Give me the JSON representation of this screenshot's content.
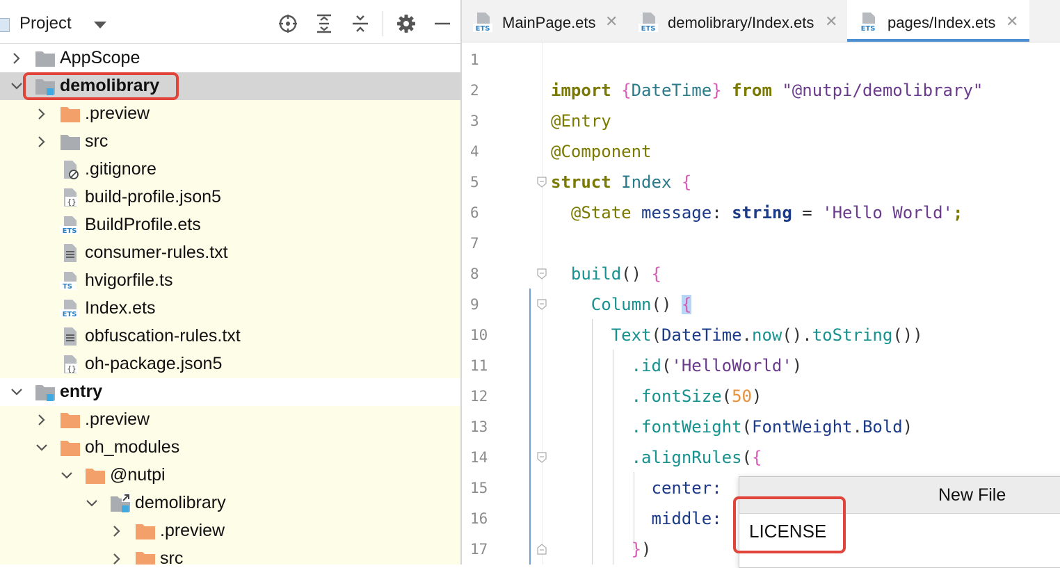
{
  "project_panel": {
    "title": "Project",
    "toolbar_icons": [
      "crosshair-icon",
      "expand-all-icon",
      "collapse-all-icon",
      "gear-icon",
      "minimize-icon"
    ],
    "tree": [
      {
        "label": "AppScope",
        "icon": "folder-icon",
        "expanded": false
      },
      {
        "label": "demolibrary",
        "icon": "module-folder-icon",
        "expanded": true,
        "selected": true,
        "bold": true
      },
      {
        "label": ".preview",
        "icon": "orange-folder-icon",
        "expanded": false
      },
      {
        "label": "src",
        "icon": "folder-icon",
        "expanded": false
      },
      {
        "label": ".gitignore",
        "icon": "ignore-file-icon"
      },
      {
        "label": "build-profile.json5",
        "icon": "json-file-icon"
      },
      {
        "label": "BuildProfile.ets",
        "icon": "ets-file-icon"
      },
      {
        "label": "consumer-rules.txt",
        "icon": "text-file-icon"
      },
      {
        "label": "hvigorfile.ts",
        "icon": "ts-file-icon"
      },
      {
        "label": "Index.ets",
        "icon": "ets-file-icon"
      },
      {
        "label": "obfuscation-rules.txt",
        "icon": "text-file-icon"
      },
      {
        "label": "oh-package.json5",
        "icon": "json-file-icon"
      },
      {
        "label": "entry",
        "icon": "module-folder-icon",
        "expanded": true,
        "bold": true
      },
      {
        "label": ".preview",
        "icon": "orange-folder-icon",
        "expanded": false
      },
      {
        "label": "oh_modules",
        "icon": "orange-folder-icon",
        "expanded": true
      },
      {
        "label": "@nutpi",
        "icon": "orange-folder-icon",
        "expanded": true
      },
      {
        "label": "demolibrary",
        "icon": "symlink-module-icon",
        "expanded": true
      },
      {
        "label": ".preview",
        "icon": "orange-folder-icon",
        "expanded": false
      },
      {
        "label": "src",
        "icon": "orange-folder-icon",
        "expanded": false
      }
    ]
  },
  "editor": {
    "tabs": [
      {
        "label": "MainPage.ets",
        "icon": "ets-file-icon",
        "active": false
      },
      {
        "label": "demolibrary/Index.ets",
        "icon": "ets-file-icon",
        "active": false
      },
      {
        "label": "pages/Index.ets",
        "icon": "ets-file-icon",
        "active": true
      }
    ],
    "line_numbers": [
      "1",
      "2",
      "3",
      "4",
      "5",
      "6",
      "7",
      "8",
      "9",
      "10",
      "11",
      "12",
      "13",
      "14",
      "15",
      "16",
      "17"
    ],
    "code": {
      "l2": [
        "import",
        " {",
        "DateTime",
        "} ",
        "from",
        " \"@nutpi/demolibrary\""
      ],
      "l3": "@Entry",
      "l4": "@Component",
      "l5": [
        "struct",
        " Index ",
        "{"
      ],
      "l6": [
        "  @State",
        " message",
        ": ",
        "string",
        " = ",
        "'Hello World'",
        ";"
      ],
      "l8": [
        "  build",
        "() ",
        "{"
      ],
      "l9": [
        "    Column",
        "() ",
        "{"
      ],
      "l10": [
        "      Text",
        "(",
        "DateTime",
        ".",
        "now",
        "()",
        ".",
        "toString",
        "())"
      ],
      "l11": [
        "        .id",
        "(",
        "'HelloWorld'",
        ")"
      ],
      "l12": [
        "        .fontSize",
        "(",
        "50",
        ")"
      ],
      "l13": [
        "        .fontWeight",
        "(",
        "FontWeight",
        ".",
        "Bold",
        ")"
      ],
      "l14": [
        "        .alignRules",
        "(",
        "{"
      ],
      "l15": "          center:",
      "l16": "          middle:",
      "l17": [
        "        }",
        ")"
      ]
    }
  },
  "new_file_dialog": {
    "title": "New File",
    "input_value": "LICENSE"
  },
  "colors": {
    "highlight_box": "#e0443a",
    "selected_row": "#d5d5d5",
    "module_highlight": "#fefde8",
    "active_tab_underline": "#4b8ed1"
  }
}
